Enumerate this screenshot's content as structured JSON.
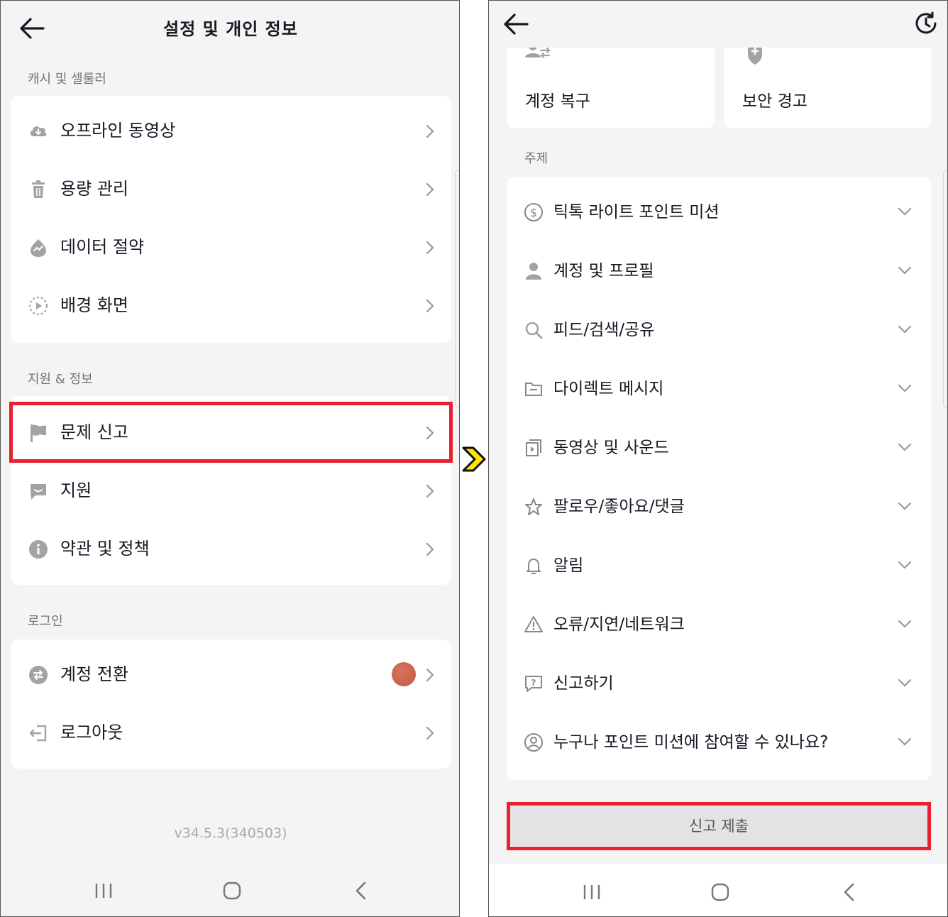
{
  "left": {
    "title": "설정 및 개인 정보",
    "sections": [
      {
        "label": "캐시 및 셀룰러",
        "items": [
          {
            "label": "오프라인 동영상",
            "icon": "cloud-download-icon"
          },
          {
            "label": "용량 관리",
            "icon": "trash-icon"
          },
          {
            "label": "데이터 절약",
            "icon": "data-saver-icon"
          },
          {
            "label": "배경 화면",
            "icon": "play-circle-icon"
          }
        ]
      },
      {
        "label": "지원 & 정보",
        "items": [
          {
            "label": "문제 신고",
            "icon": "flag-icon"
          },
          {
            "label": "지원",
            "icon": "support-chat-icon"
          },
          {
            "label": "약관 및 정책",
            "icon": "info-icon"
          }
        ]
      },
      {
        "label": "로그인",
        "items": [
          {
            "label": "계정 전환",
            "icon": "switch-account-icon"
          },
          {
            "label": "로그아웃",
            "icon": "logout-icon"
          }
        ]
      }
    ],
    "version": "v34.5.3(340503)"
  },
  "right": {
    "top_cards": [
      {
        "label": "계정 복구",
        "icon": "account-recovery-icon"
      },
      {
        "label": "보안 경고",
        "icon": "security-shield-icon"
      }
    ],
    "topics_label": "주제",
    "topics": [
      {
        "label": "틱톡 라이트 포인트 미션",
        "icon": "dollar-circle-icon"
      },
      {
        "label": "계정 및 프로필",
        "icon": "person-icon"
      },
      {
        "label": "피드/검색/공유",
        "icon": "search-icon"
      },
      {
        "label": "다이렉트 메시지",
        "icon": "folder-icon"
      },
      {
        "label": "동영상 및 사운드",
        "icon": "video-icon"
      },
      {
        "label": "팔로우/좋아요/댓글",
        "icon": "star-icon"
      },
      {
        "label": "알림",
        "icon": "bell-icon"
      },
      {
        "label": "오류/지연/네트워크",
        "icon": "warning-icon"
      },
      {
        "label": "신고하기",
        "icon": "report-question-icon"
      },
      {
        "label": "누구나 포인트 미션에 참여할 수 있나요?",
        "icon": "user-circle-icon"
      }
    ],
    "submit_label": "신고 제출"
  },
  "colors": {
    "highlight": "#e8202f",
    "arrow_fill": "#ffe600",
    "background": "#f4f4f4",
    "icon_gray": "#a3a3a3"
  }
}
